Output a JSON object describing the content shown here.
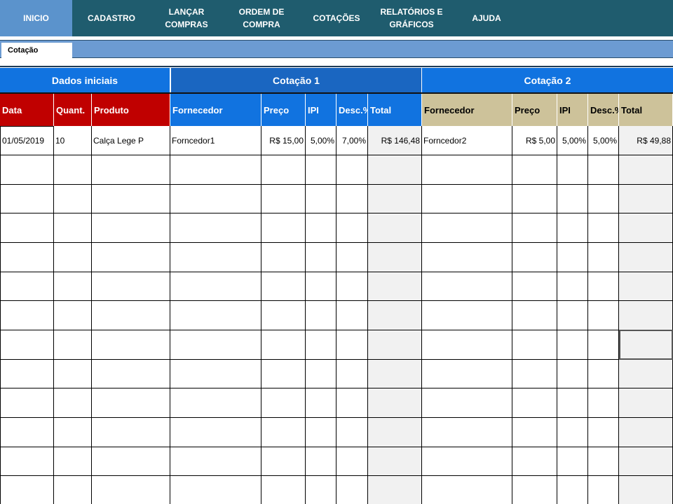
{
  "nav": {
    "items": [
      {
        "label": "INICIO",
        "active": true
      },
      {
        "label": "CADASTRO",
        "active": false
      },
      {
        "label": "LANÇAR\nCOMPRAS",
        "active": false
      },
      {
        "label": "ORDEM DE\nCOMPRA",
        "active": false
      },
      {
        "label": "COTAÇÕES",
        "active": false
      },
      {
        "label": "RELATÓRIOS E\nGRÁFICOS",
        "active": false
      },
      {
        "label": "AJUDA",
        "active": false
      }
    ]
  },
  "subtab": {
    "label": "Cotação"
  },
  "groups": [
    {
      "label": "Dados iniciais",
      "color": "#1173e0"
    },
    {
      "label": "Cotação 1",
      "color": "#1a66c1"
    },
    {
      "label": "Cotação 2",
      "color": "#1173e0"
    }
  ],
  "columns": [
    {
      "label": "Data",
      "bg": "#c00000",
      "fg": "#ffffff"
    },
    {
      "label": "Quant.",
      "bg": "#c00000",
      "fg": "#ffffff"
    },
    {
      "label": "Produto",
      "bg": "#c00000",
      "fg": "#ffffff"
    },
    {
      "label": "Fornecedor",
      "bg": "#1173e0",
      "fg": "#ffffff"
    },
    {
      "label": "Preço",
      "bg": "#1173e0",
      "fg": "#ffffff"
    },
    {
      "label": "IPI",
      "bg": "#1173e0",
      "fg": "#ffffff"
    },
    {
      "label": "Desc.%",
      "bg": "#1173e0",
      "fg": "#ffffff"
    },
    {
      "label": "Total",
      "bg": "#1173e0",
      "fg": "#ffffff"
    },
    {
      "label": "Fornecedor",
      "bg": "#cdc29a",
      "fg": "#000000"
    },
    {
      "label": "Preço",
      "bg": "#cdc29a",
      "fg": "#000000"
    },
    {
      "label": "IPI",
      "bg": "#cdc29a",
      "fg": "#000000"
    },
    {
      "label": "Desc.%",
      "bg": "#cdc29a",
      "fg": "#000000"
    },
    {
      "label": "Total",
      "bg": "#cdc29a",
      "fg": "#000000"
    }
  ],
  "rows": [
    [
      "01/05/2019",
      "10",
      "Calça Lege P",
      "Forncedor1",
      "R$ 15,00",
      "5,00%",
      "7,00%",
      "R$ 146,48",
      "Forncedor2",
      "R$ 5,00",
      "5,00%",
      "5,00%",
      "R$ 49,88"
    ],
    [
      "",
      "",
      "",
      "",
      "",
      "",
      "",
      "",
      "",
      "",
      "",
      "",
      ""
    ],
    [
      "",
      "",
      "",
      "",
      "",
      "",
      "",
      "",
      "",
      "",
      "",
      "",
      ""
    ],
    [
      "",
      "",
      "",
      "",
      "",
      "",
      "",
      "",
      "",
      "",
      "",
      "",
      ""
    ],
    [
      "",
      "",
      "",
      "",
      "",
      "",
      "",
      "",
      "",
      "",
      "",
      "",
      ""
    ],
    [
      "",
      "",
      "",
      "",
      "",
      "",
      "",
      "",
      "",
      "",
      "",
      "",
      ""
    ],
    [
      "",
      "",
      "",
      "",
      "",
      "",
      "",
      "",
      "",
      "",
      "",
      "",
      ""
    ],
    [
      "",
      "",
      "",
      "",
      "",
      "",
      "",
      "",
      "",
      "",
      "",
      "",
      ""
    ],
    [
      "",
      "",
      "",
      "",
      "",
      "",
      "",
      "",
      "",
      "",
      "",
      "",
      ""
    ],
    [
      "",
      "",
      "",
      "",
      "",
      "",
      "",
      "",
      "",
      "",
      "",
      "",
      ""
    ],
    [
      "",
      "",
      "",
      "",
      "",
      "",
      "",
      "",
      "",
      "",
      "",
      "",
      ""
    ],
    [
      "",
      "",
      "",
      "",
      "",
      "",
      "",
      "",
      "",
      "",
      "",
      "",
      ""
    ],
    [
      "",
      "",
      "",
      "",
      "",
      "",
      "",
      "",
      "",
      "",
      "",
      "",
      ""
    ]
  ]
}
